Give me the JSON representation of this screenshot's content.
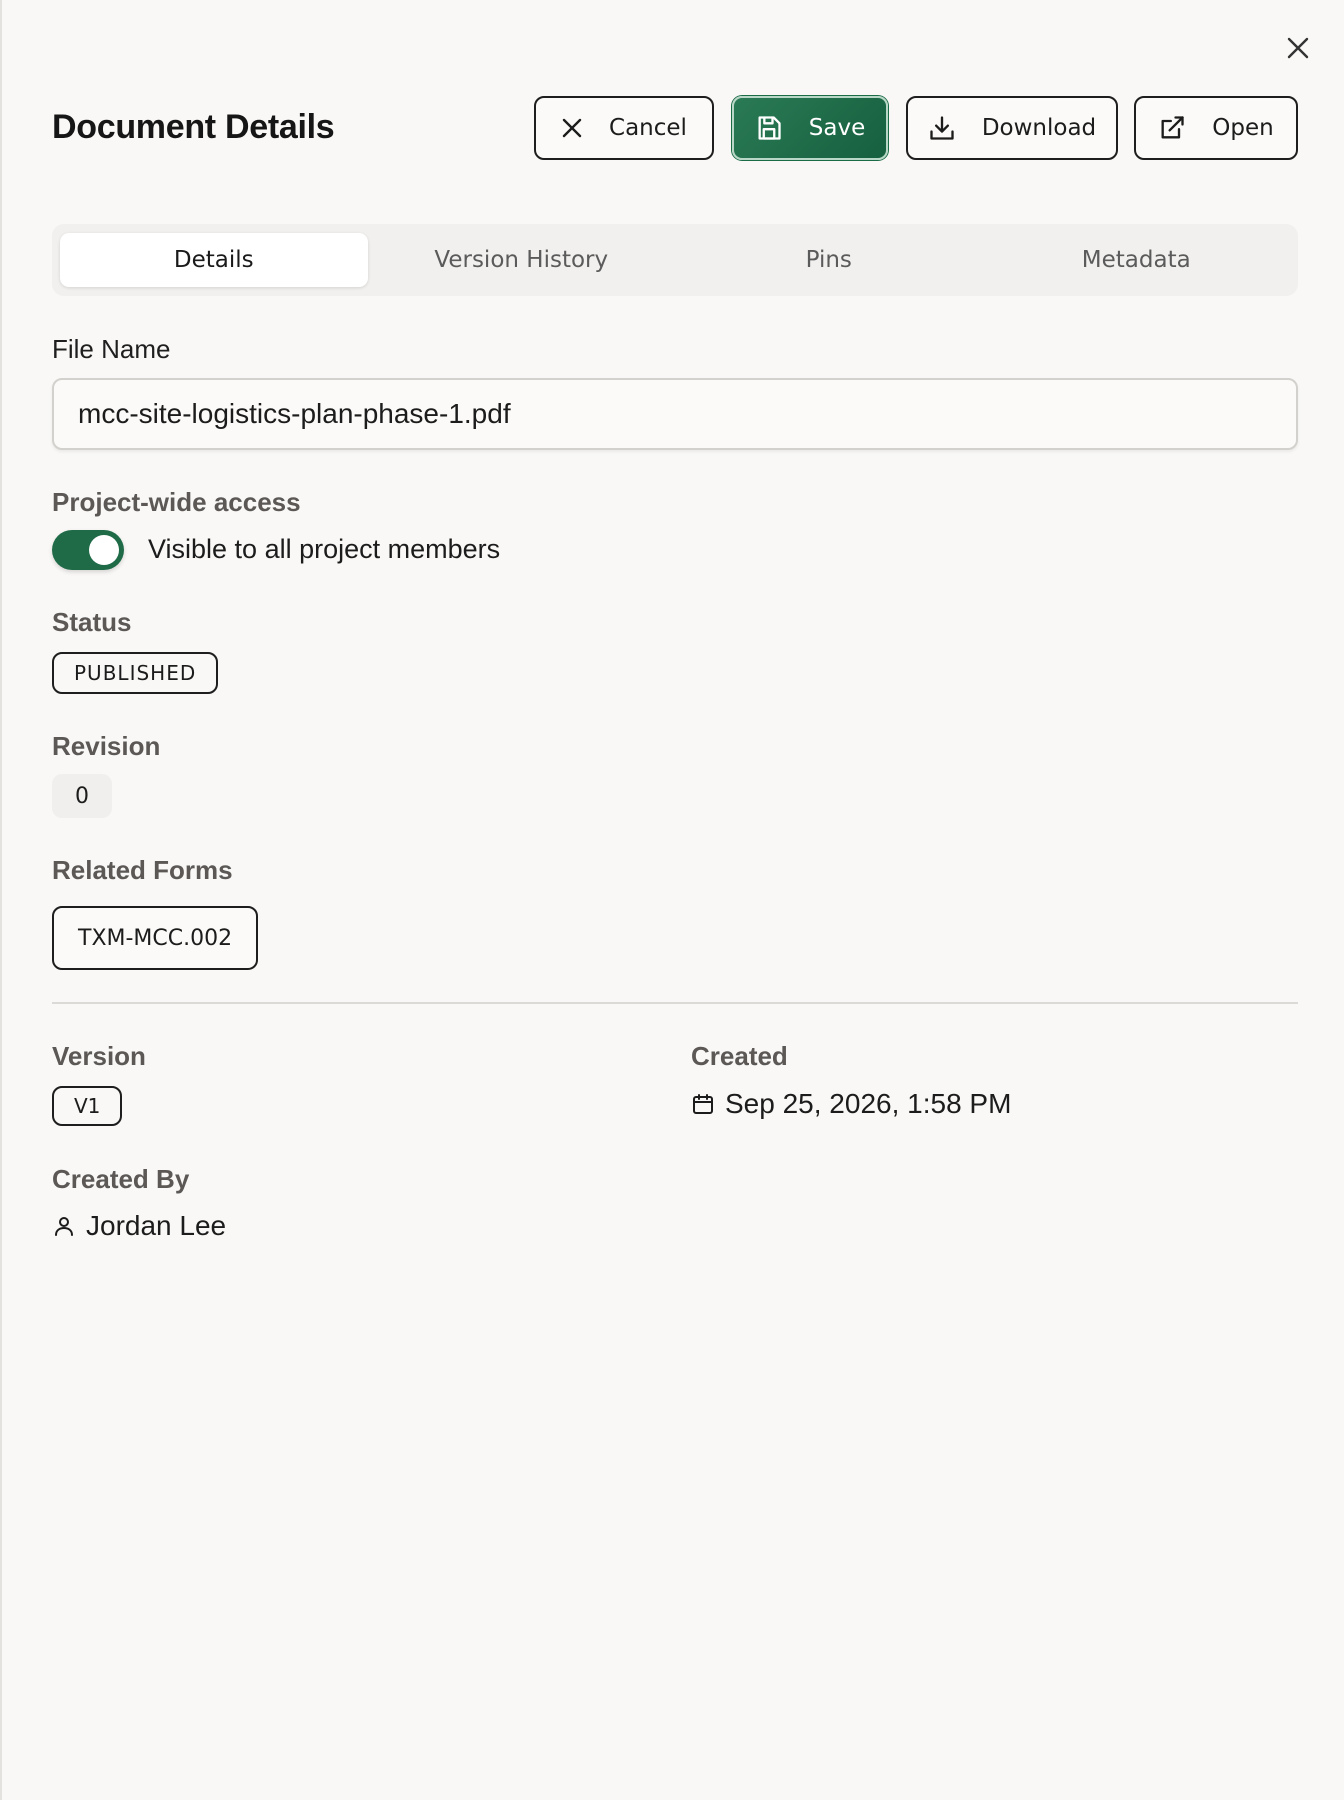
{
  "header": {
    "title": "Document Details",
    "close_icon": "close-icon"
  },
  "toolbar": {
    "cancel_label": "Cancel",
    "save_label": "Save",
    "download_label": "Download",
    "open_label": "Open",
    "accent_color": "#1f6b48"
  },
  "tabs": [
    {
      "label": "Details",
      "active": true
    },
    {
      "label": "Version History",
      "active": false
    },
    {
      "label": "Pins",
      "active": false
    },
    {
      "label": "Metadata",
      "active": false
    }
  ],
  "details": {
    "file_name_label": "File Name",
    "file_name_value": "mcc-site-logistics-plan-phase-1.pdf",
    "access_label": "Project-wide access",
    "access_toggle_text": "Visible to all project members",
    "access_enabled": true,
    "status_label": "Status",
    "status_value": "PUBLISHED",
    "revision_label": "Revision",
    "revision_value": "0",
    "related_forms_label": "Related Forms",
    "related_forms": [
      "TXM-MCC.002"
    ],
    "version_label": "Version",
    "version_value": "V1",
    "created_label": "Created",
    "created_value": "Sep 25, 2026, 1:58 PM",
    "created_by_label": "Created By",
    "created_by_value": "Jordan Lee"
  }
}
